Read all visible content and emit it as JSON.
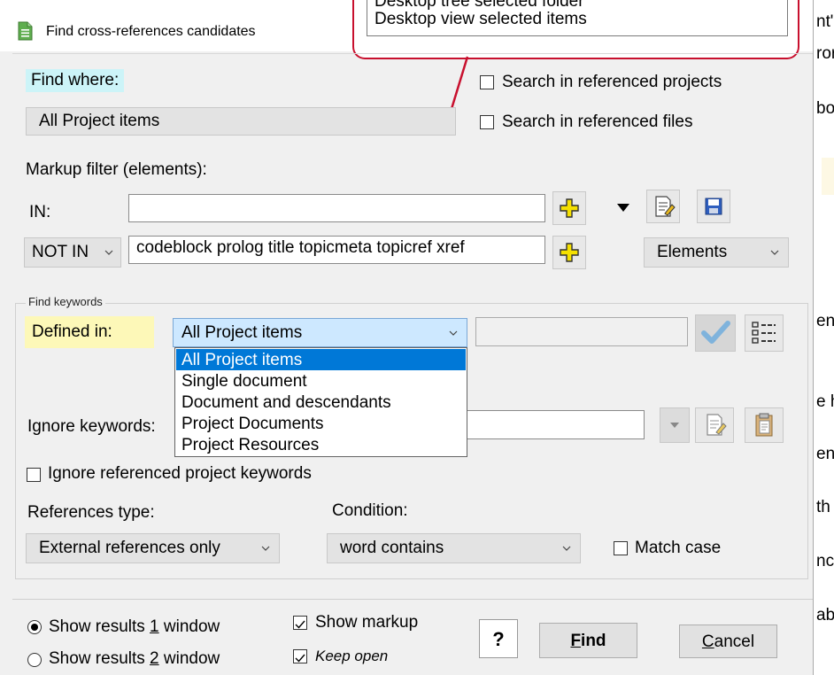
{
  "background_doc": {
    "fragments": [
      "nt\"",
      "ror",
      "bo",
      "ent",
      "e h",
      "ent",
      "th",
      "nch",
      "ab"
    ]
  },
  "dialog": {
    "title": "Find cross-references candidates",
    "callout": {
      "items": [
        "Desktop tree selected folder",
        "Desktop view selected items"
      ]
    },
    "find_where": {
      "label": "Find where:",
      "value": "All Project items",
      "search_ref_projects": "Search in referenced projects",
      "search_ref_files": "Search in referenced files"
    },
    "markup_filter": {
      "label": "Markup filter (elements):",
      "in_label": "IN:",
      "in_value": "",
      "not_in_select": "NOT IN",
      "not_in_value": "codeblock prolog title topicmeta topicref xref",
      "elements_select": "Elements"
    },
    "find_keywords": {
      "group_title": "Find keywords",
      "defined_in_label": "Defined in:",
      "defined_in_value": "All Project items",
      "dropdown_options": [
        "All Project items",
        "Single document",
        "Document and descendants",
        "Project Documents",
        "Project Resources"
      ],
      "ignore_keywords_label": "Ignore keywords:",
      "ignore_ref_project_keywords": "Ignore referenced project keywords",
      "references_type_label": "References type:",
      "references_type_value": "External references only",
      "condition_label": "Condition:",
      "condition_value": "word contains",
      "match_case": "Match case"
    },
    "footer": {
      "show_results_1_prefix": "Show results ",
      "show_results_1_key": "1",
      "show_results_1_suffix": " window",
      "show_results_2_prefix": "Show results ",
      "show_results_2_key": "2",
      "show_results_2_suffix": " window",
      "show_markup": "Show markup",
      "keep_open": "Keep open",
      "help": "?",
      "find_key": "F",
      "find_rest": "ind",
      "cancel_key": "C",
      "cancel_rest": "ancel"
    }
  },
  "colors": {
    "find_where_bg": "#ccf4f8",
    "defined_in_bg": "#fdf8b8",
    "selection": "#0078d7",
    "callout_border": "#c8102e"
  }
}
